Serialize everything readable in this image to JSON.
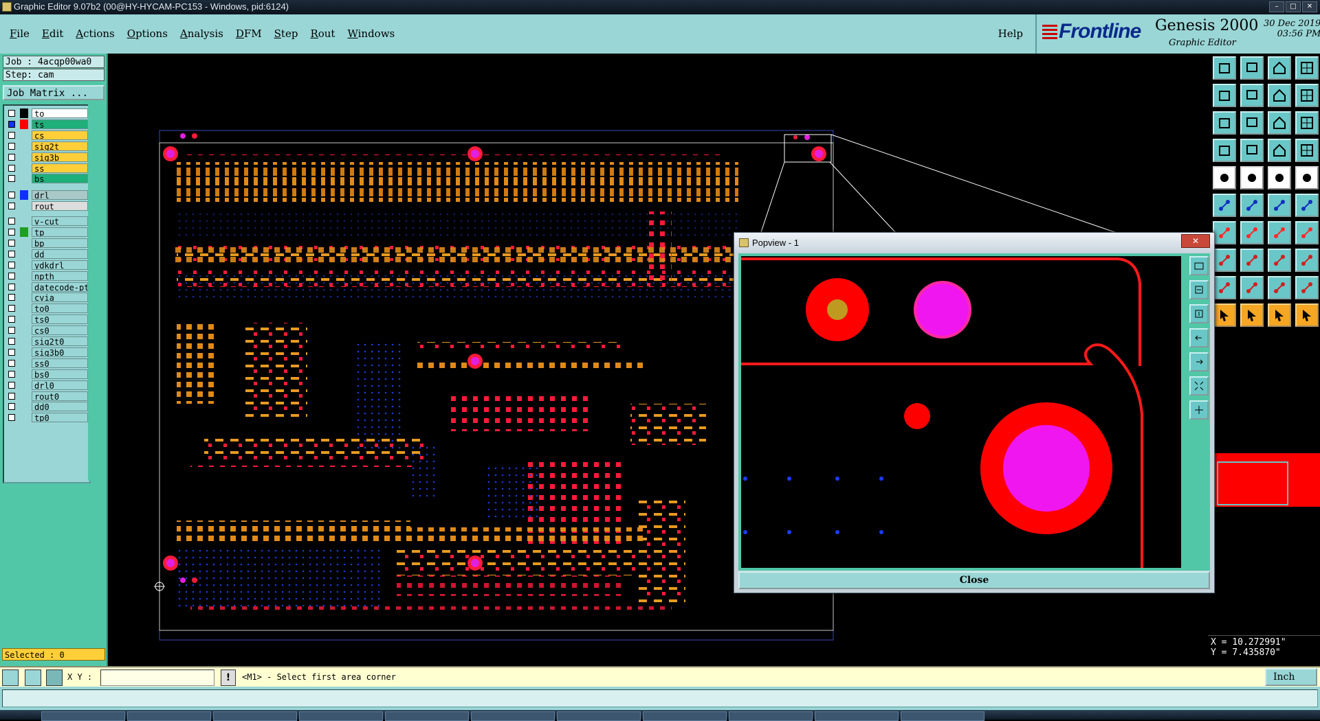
{
  "window_title": "Graphic Editor 9.07b2 (00@HY-HYCAM-PC153 - Windows, pid:6124)",
  "menu": [
    "File",
    "Edit",
    "Actions",
    "Options",
    "Analysis",
    "DFM",
    "Step",
    "Rout",
    "Windows"
  ],
  "help_label": "Help",
  "brand": {
    "logo": "Frontline",
    "product": "Genesis 2000",
    "subtitle": "Graphic Editor",
    "date": "30 Dec 2019",
    "time": "03:56 PM"
  },
  "job_label": "Job : 4acqp00wa0",
  "step_label": "Step: cam",
  "job_matrix_label": "Job Matrix ...",
  "layers": [
    {
      "name": "to",
      "color": "#000000",
      "bg": "#ffffff",
      "selected": false
    },
    {
      "name": "ts",
      "color": "#ff0000",
      "bg": "#1faf7a",
      "selected": true
    },
    {
      "name": "cs",
      "color": "",
      "bg": "#ffcf3a",
      "selected": false
    },
    {
      "name": "sig2t",
      "color": "",
      "bg": "#ffcf3a",
      "selected": false
    },
    {
      "name": "sig3b",
      "color": "",
      "bg": "#ffcf3a",
      "selected": false
    },
    {
      "name": "ss",
      "color": "",
      "bg": "#ffcf3a",
      "selected": false
    },
    {
      "name": "bs",
      "color": "",
      "bg": "#1faf7a",
      "selected": false
    },
    {
      "name": "drl",
      "color": "#1030ff",
      "bg": "#a9c9c9",
      "selected": false
    },
    {
      "name": "rout",
      "color": "",
      "bg": "#dddddd",
      "selected": false
    },
    {
      "name": "v-cut",
      "color": "",
      "bg": "#9ad6d6",
      "selected": false
    },
    {
      "name": "tp",
      "color": "#1f9f1f",
      "bg": "#9ad6d6",
      "selected": false
    },
    {
      "name": "bp",
      "color": "",
      "bg": "#9ad6d6",
      "selected": false
    },
    {
      "name": "dd",
      "color": "",
      "bg": "#9ad6d6",
      "selected": false
    },
    {
      "name": "ydkdrl",
      "color": "",
      "bg": "#9ad6d6",
      "selected": false
    },
    {
      "name": "npth",
      "color": "",
      "bg": "#9ad6d6",
      "selected": false
    },
    {
      "name": "datecode-pt",
      "color": "",
      "bg": "#9ad6d6",
      "selected": false
    },
    {
      "name": "cvia",
      "color": "",
      "bg": "#9ad6d6",
      "selected": false
    },
    {
      "name": "to0",
      "color": "",
      "bg": "#9ad6d6",
      "selected": false
    },
    {
      "name": "ts0",
      "color": "",
      "bg": "#9ad6d6",
      "selected": false
    },
    {
      "name": "cs0",
      "color": "",
      "bg": "#9ad6d6",
      "selected": false
    },
    {
      "name": "sig2t0",
      "color": "",
      "bg": "#9ad6d6",
      "selected": false
    },
    {
      "name": "sig3b0",
      "color": "",
      "bg": "#9ad6d6",
      "selected": false
    },
    {
      "name": "ss0",
      "color": "",
      "bg": "#9ad6d6",
      "selected": false
    },
    {
      "name": "bs0",
      "color": "",
      "bg": "#9ad6d6",
      "selected": false
    },
    {
      "name": "drl0",
      "color": "",
      "bg": "#9ad6d6",
      "selected": false
    },
    {
      "name": "rout0",
      "color": "",
      "bg": "#9ad6d6",
      "selected": false
    },
    {
      "name": "dd0",
      "color": "",
      "bg": "#9ad6d6",
      "selected": false
    },
    {
      "name": "tp0",
      "color": "",
      "bg": "#9ad6d6",
      "selected": false
    }
  ],
  "selected_label": "Selected : 0",
  "popview": {
    "title": "Popview - 1",
    "close_label": "Close",
    "x_glyph": "✕"
  },
  "coords": {
    "x": "X = 10.272991\"",
    "y": "Y = 7.435870\""
  },
  "status": {
    "xy_label": "X Y :",
    "xy_value": "",
    "message": "<M1> - Select first area corner",
    "units": "Inch"
  },
  "toolbox_icons": [
    "snap-icon",
    "save-icon",
    "home-icon",
    "grid-icon",
    "prev-icon",
    "next-icon",
    "step-icon",
    "undo-icon",
    "fit-icon",
    "zoom-icon",
    "scale-icon",
    "help-icon",
    "measure-icon",
    "feature-icon",
    "layers-icon",
    "layers2-icon",
    "drill-icon",
    "line-icon",
    "ruler-icon",
    "pad-icon",
    "net-icon",
    "cross-icon",
    "connect-icon",
    "disconnect-icon",
    "draw-icon",
    "slash-icon",
    "arc-icon",
    "tp-icon",
    "add-icon",
    "minus-icon",
    "align-icon",
    "group-icon",
    "triangle-icon",
    "triangle2-icon",
    "triangle3-icon",
    "triangle4-icon",
    "pointer-icon",
    "pointer2-icon",
    "pointer3-icon",
    "pointer4-icon"
  ]
}
